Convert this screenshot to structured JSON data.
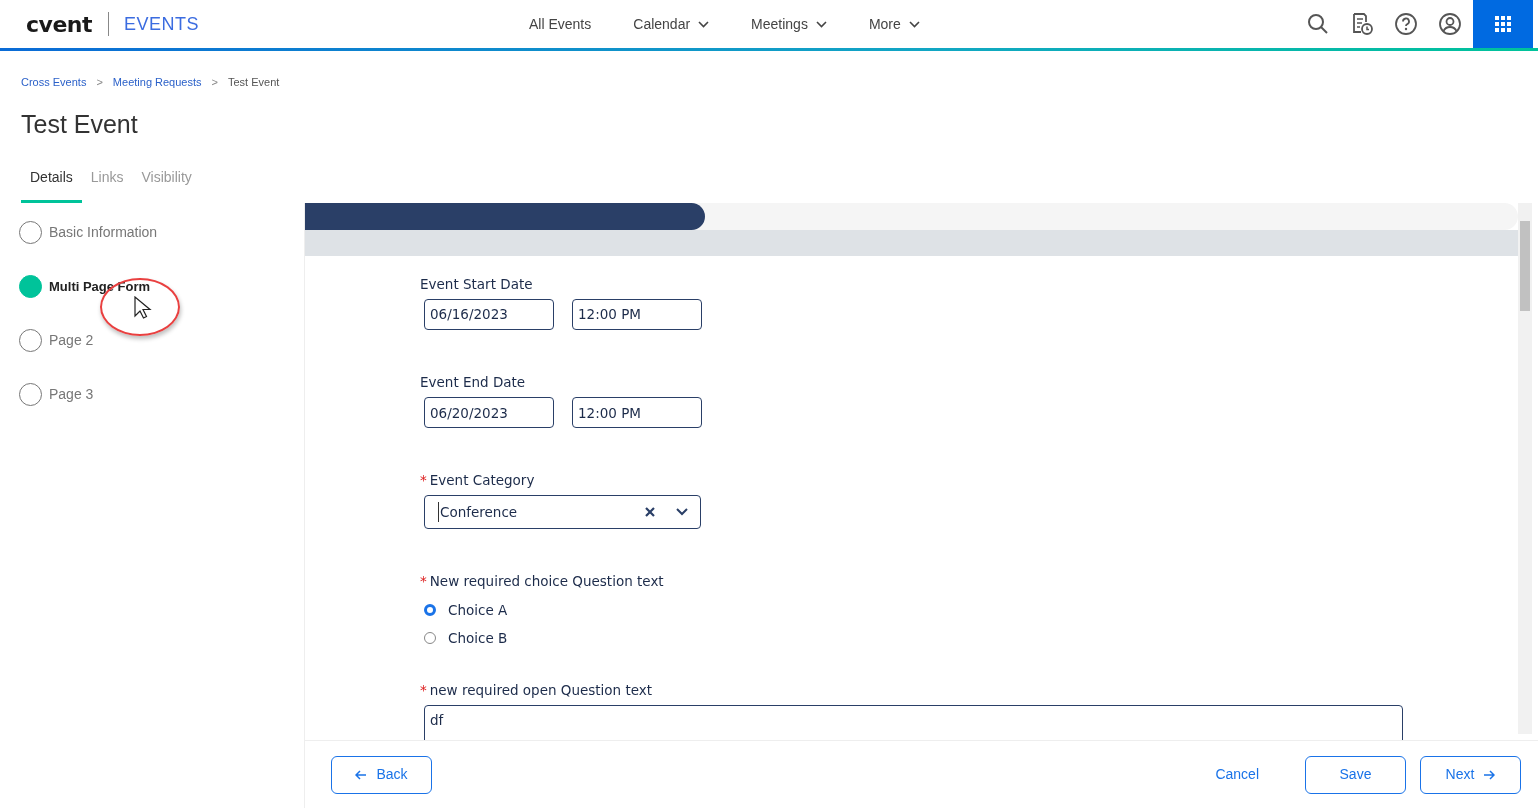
{
  "header": {
    "logo": "cvent",
    "product": "EVENTS",
    "nav": [
      {
        "label": "All Events",
        "dropdown": false
      },
      {
        "label": "Calendar",
        "dropdown": true
      },
      {
        "label": "Meetings",
        "dropdown": true
      },
      {
        "label": "More",
        "dropdown": true
      }
    ]
  },
  "breadcrumb": [
    {
      "label": "Cross Events",
      "link": true
    },
    {
      "separator": ">",
      "label": "Meeting Requests",
      "link": true
    },
    {
      "separator": ">",
      "label": "Test Event",
      "link": false
    }
  ],
  "title": "Test Event",
  "tabs": [
    {
      "label": "Details",
      "selected": true
    },
    {
      "label": "Links",
      "selected": false
    },
    {
      "label": "Visibility",
      "selected": false
    }
  ],
  "steps": [
    {
      "label": "Basic Information",
      "selected": false
    },
    {
      "label": "Multi Page Form",
      "selected": true
    },
    {
      "label": "Page 2",
      "selected": false
    },
    {
      "label": "Page 3",
      "selected": false
    }
  ],
  "progress": {
    "level": 0.33
  },
  "form": [
    {
      "kind": "datetime",
      "label": "Event Start Date",
      "date": "06/16/2023",
      "time": "12:00 PM"
    },
    {
      "kind": "datetime",
      "label": "Event End Date",
      "date": "06/20/2023",
      "time": "12:00 PM"
    },
    {
      "kind": "select",
      "required_mark": "*",
      "label": "Event Category",
      "value": "Conference"
    },
    {
      "kind": "choice",
      "required_mark": "*",
      "label": "New required choice Question text",
      "options": [
        {
          "label": "Choice A",
          "selected": true
        },
        {
          "label": "Choice B",
          "selected": false
        }
      ]
    },
    {
      "kind": "text",
      "required_mark": "*",
      "label": "new required open Question text",
      "value": "df"
    }
  ],
  "footer": {
    "back": "Back",
    "cancel": "Cancel",
    "save": "Save",
    "next": "Next"
  }
}
